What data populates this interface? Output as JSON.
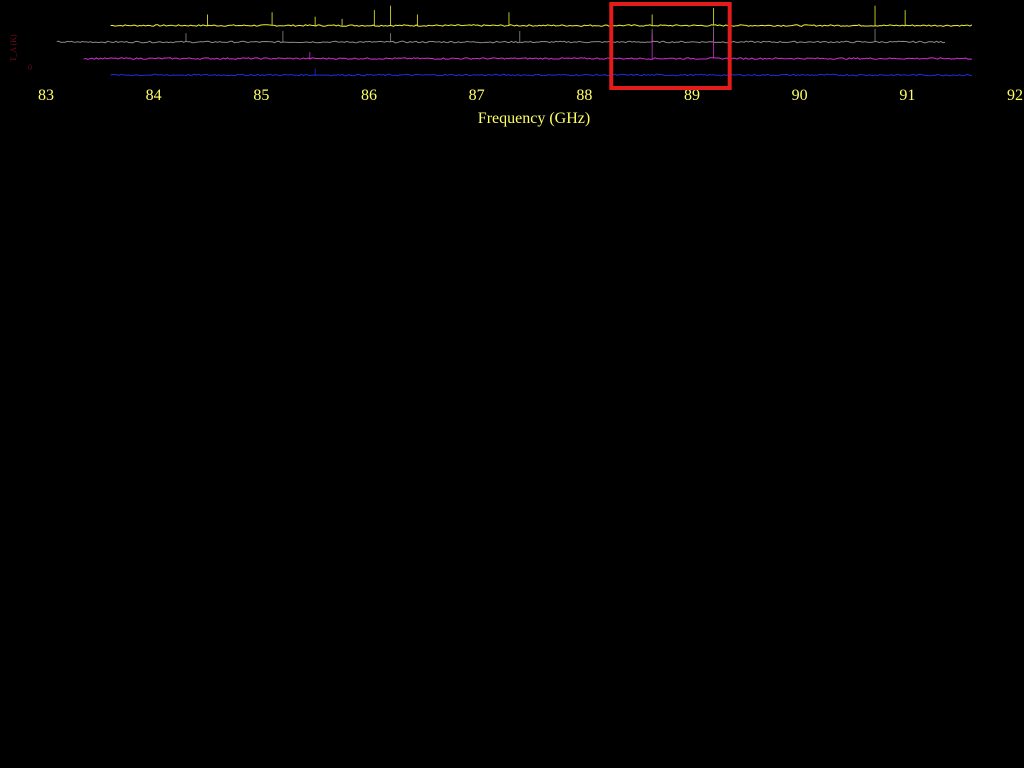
{
  "chart_data": {
    "type": "line",
    "xlabel": "Frequency (GHz)",
    "ylabel": "T_A (K)",
    "y_tick_labels": [
      "0"
    ],
    "x_ticks": [
      83,
      84,
      85,
      86,
      87,
      88,
      89,
      90,
      91,
      92
    ],
    "xlim": [
      83,
      92
    ],
    "grid": false,
    "highlight": {
      "x_range": [
        88.25,
        89.35
      ]
    },
    "series": [
      {
        "color": "#f2ef2c",
        "x_range": [
          83.6,
          91.6
        ],
        "offset": 3,
        "features": [
          {
            "x": 84.5,
            "amp": 0.5
          },
          {
            "x": 85.1,
            "amp": 0.6
          },
          {
            "x": 85.5,
            "amp": 0.4
          },
          {
            "x": 85.75,
            "amp": 0.3
          },
          {
            "x": 86.05,
            "amp": 0.7
          },
          {
            "x": 86.2,
            "amp": 0.9
          },
          {
            "x": 86.45,
            "amp": 0.5
          },
          {
            "x": 87.3,
            "amp": 0.6
          },
          {
            "x": 88.63,
            "amp": 0.5
          },
          {
            "x": 89.2,
            "amp": 0.8
          },
          {
            "x": 90.7,
            "amp": 0.9
          },
          {
            "x": 90.98,
            "amp": 0.7
          }
        ]
      },
      {
        "color": "#8a8a8a",
        "x_range": [
          83.1,
          91.35
        ],
        "offset": 2,
        "features": [
          {
            "x": 84.3,
            "amp": 0.4
          },
          {
            "x": 85.2,
            "amp": 0.5
          },
          {
            "x": 86.2,
            "amp": 0.4
          },
          {
            "x": 87.4,
            "amp": 0.5
          },
          {
            "x": 88.63,
            "amp": 0.6
          },
          {
            "x": 89.2,
            "amp": 0.7
          },
          {
            "x": 90.7,
            "amp": 0.6
          }
        ]
      },
      {
        "color": "#d22ed2",
        "x_range": [
          83.35,
          91.6
        ],
        "offset": 1,
        "features": [
          {
            "x": 85.45,
            "amp": 0.3
          },
          {
            "x": 88.63,
            "amp": 1.1
          },
          {
            "x": 89.2,
            "amp": 0.9
          }
        ]
      },
      {
        "color": "#1b2ee6",
        "x_range": [
          83.6,
          91.6
        ],
        "offset": 0,
        "features": [
          {
            "x": 85.5,
            "amp": 0.3
          }
        ]
      }
    ]
  },
  "colors": {
    "background": "#000000",
    "axis_text": "#ffff66",
    "highlight_box": "#e21b1b",
    "y_label_text": "#6e0e1e"
  }
}
